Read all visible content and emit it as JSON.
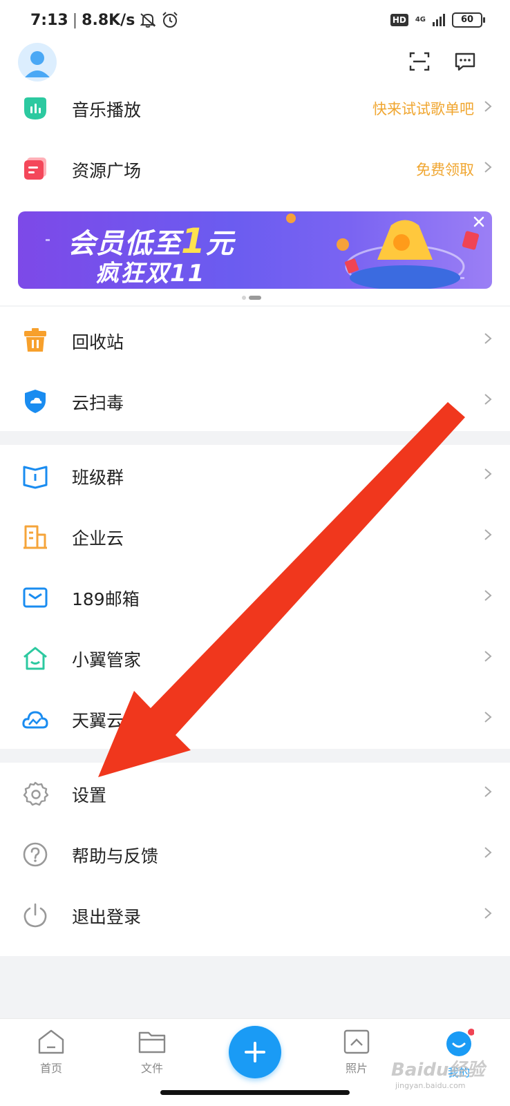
{
  "status_bar": {
    "time": "7:13",
    "speed": "8.8K/s",
    "hd": "HD",
    "network": "4G",
    "battery": "60"
  },
  "header": {
    "avatar": "avatar",
    "scan_icon": "scan-icon",
    "message_icon": "message-icon"
  },
  "menu_group_1": [
    {
      "label": "音乐播放",
      "hint": "快来试试歌单吧",
      "icon": "music-icon"
    },
    {
      "label": "资源广场",
      "hint": "免费领取",
      "icon": "resource-icon"
    }
  ],
  "banner": {
    "line1_prefix": "会员低至",
    "line1_num": "1",
    "line1_suffix": "元",
    "line2": "疯狂双11",
    "colors": [
      "#7d49e8",
      "#9b7ff5"
    ]
  },
  "menu_group_2": [
    {
      "label": "回收站",
      "icon": "trash-icon"
    },
    {
      "label": "云扫毒",
      "icon": "shield-icon"
    }
  ],
  "menu_group_3": [
    {
      "label": "班级群",
      "icon": "class-book-icon"
    },
    {
      "label": "企业云",
      "icon": "building-icon"
    },
    {
      "label": "189邮箱",
      "icon": "mail-icon"
    },
    {
      "label": "小翼管家",
      "icon": "home-icon"
    },
    {
      "label": "天翼云",
      "icon": "cloud-icon"
    }
  ],
  "menu_group_4": [
    {
      "label": "设置",
      "icon": "gear-icon"
    },
    {
      "label": "帮助与反馈",
      "icon": "help-icon"
    },
    {
      "label": "退出登录",
      "icon": "power-icon"
    }
  ],
  "tab_bar": [
    {
      "label": "首页",
      "icon": "home-tab-icon"
    },
    {
      "label": "文件",
      "icon": "folder-icon"
    },
    {
      "label": "",
      "icon": "plus-icon"
    },
    {
      "label": "照片",
      "icon": "photo-icon"
    },
    {
      "label": "我的",
      "icon": "profile-icon"
    }
  ],
  "accent_color": "#1a9bf5",
  "hint_color": "#f0a630",
  "watermark": {
    "brand": "Baidu经验",
    "url": "jingyan.baidu.com"
  }
}
